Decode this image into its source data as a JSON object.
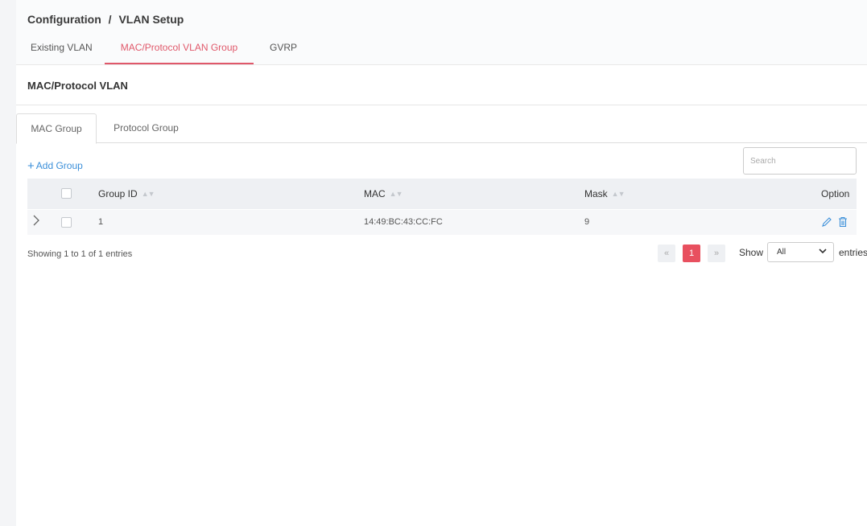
{
  "breadcrumb": {
    "parent": "Configuration",
    "separator": "/",
    "current": "VLAN Setup"
  },
  "top_tabs": [
    {
      "label": "Existing VLAN",
      "active": false
    },
    {
      "label": "MAC/Protocol VLAN Group",
      "active": true
    },
    {
      "label": "GVRP",
      "active": false
    }
  ],
  "card": {
    "title": "MAC/Protocol VLAN"
  },
  "sub_tabs": [
    {
      "label": "MAC Group",
      "active": true
    },
    {
      "label": "Protocol Group",
      "active": false
    }
  ],
  "toolbar": {
    "add_group_label": "Add Group",
    "add_group_icon": "plus-icon",
    "search_placeholder": "Search",
    "search_value": ""
  },
  "table": {
    "columns": {
      "group_id": "Group ID",
      "mac": "MAC",
      "mask": "Mask",
      "option": "Option"
    },
    "rows": [
      {
        "group_id": "1",
        "mac": "14:49:BC:43:CC:FC",
        "mask": "9",
        "actions": [
          "edit-icon",
          "delete-icon"
        ]
      }
    ]
  },
  "footer": {
    "info": "Showing 1 to 1 of 1 entries",
    "pager": {
      "prev": "«",
      "current": "1",
      "next": "»"
    },
    "show_label": "Show",
    "entries_value": "All",
    "entries_label": "entries"
  },
  "colors": {
    "accent": "#e0586a",
    "link": "#3b8fd9",
    "pager_active": "#e8505f"
  }
}
